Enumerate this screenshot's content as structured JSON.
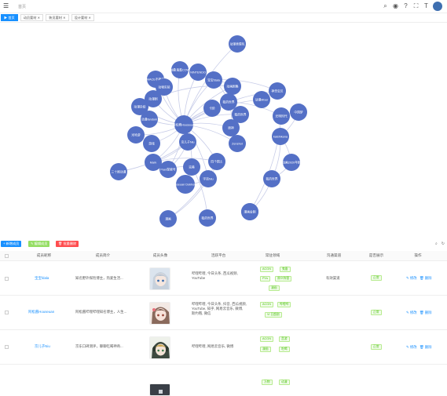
{
  "topbar": {
    "breadcrumb": "首页"
  },
  "tabs": [
    {
      "label": "▶ 首页"
    },
    {
      "label": "动员要材 ✕"
    },
    {
      "label": "装员要材 ✕"
    },
    {
      "label": "设计要材 ✕"
    }
  ],
  "colors": {
    "node": "#5470c6",
    "edge": "#c8cde8",
    "primary": "#1890ff",
    "success": "#52c41a",
    "danger": "#ff4d4f",
    "success_light": "#95de64"
  },
  "graph": {
    "nodes": [
      {
        "id": "n1",
        "label": "动漫表情包"
      },
      {
        "id": "n2",
        "label": "抽象鬼畜COW"
      },
      {
        "id": "n3",
        "label": "NINTENDO"
      },
      {
        "id": "n4",
        "label": "MACE不稳定"
      },
      {
        "id": "n5",
        "label": "动物实验"
      },
      {
        "id": "n6",
        "label": "宝宝fdala"
      },
      {
        "id": "n7",
        "label": "动画剧集"
      },
      {
        "id": "n8",
        "label": "动漫剧"
      },
      {
        "id": "n9",
        "label": "我的世界"
      },
      {
        "id": "n10",
        "label": "神奇宝贝"
      },
      {
        "id": "n11",
        "label": "动漫Mixer"
      },
      {
        "id": "n12",
        "label": "动漫杂烩"
      },
      {
        "id": "n13",
        "label": "动漫fandom"
      },
      {
        "id": "n14",
        "label": "阿松酱Houseuan"
      },
      {
        "id": "n15",
        "label": "卡阶"
      },
      {
        "id": "n16",
        "label": "我的世界"
      },
      {
        "id": "n17",
        "label": "原神"
      },
      {
        "id": "n18",
        "label": "米哈游"
      },
      {
        "id": "n19",
        "label": "游戏"
      },
      {
        "id": "n20",
        "label": "Zenshot"
      },
      {
        "id": "n21",
        "label": "京儿子Niu"
      },
      {
        "id": "n22",
        "label": "Mark"
      },
      {
        "id": "n23",
        "label": "Peer探索号"
      },
      {
        "id": "n24",
        "label": "完美"
      },
      {
        "id": "n25",
        "label": "四个国土"
      },
      {
        "id": "n26",
        "label": "三十剧动漫"
      },
      {
        "id": "n27",
        "label": "宇宙Niu"
      },
      {
        "id": "n28",
        "label": "Houseuan Dokholidal"
      },
      {
        "id": "n29",
        "label": "漫画"
      },
      {
        "id": "n30",
        "label": "我的世界"
      },
      {
        "id": "n31",
        "label": "光荣"
      },
      {
        "id": "n32",
        "label": "光明时代"
      },
      {
        "id": "n33",
        "label": "中国梦"
      },
      {
        "id": "n34",
        "label": "kaishikana"
      },
      {
        "id": "n35",
        "label": "动画2020年剧"
      },
      {
        "id": "n36",
        "label": "我的世界"
      },
      {
        "id": "n37",
        "label": "漫画金刚"
      }
    ],
    "edges": [
      [
        "n14",
        "n1"
      ],
      [
        "n14",
        "n2"
      ],
      [
        "n14",
        "n3"
      ],
      [
        "n14",
        "n4"
      ],
      [
        "n14",
        "n5"
      ],
      [
        "n14",
        "n6"
      ],
      [
        "n14",
        "n7"
      ],
      [
        "n14",
        "n8"
      ],
      [
        "n14",
        "n9"
      ],
      [
        "n14",
        "n10"
      ],
      [
        "n14",
        "n11"
      ],
      [
        "n14",
        "n12"
      ],
      [
        "n14",
        "n13"
      ],
      [
        "n14",
        "n15"
      ],
      [
        "n14",
        "n16"
      ],
      [
        "n14",
        "n17"
      ],
      [
        "n14",
        "n18"
      ],
      [
        "n14",
        "n19"
      ],
      [
        "n14",
        "n20"
      ],
      [
        "n14",
        "n21"
      ],
      [
        "n14",
        "n22"
      ],
      [
        "n14",
        "n23"
      ],
      [
        "n14",
        "n24"
      ],
      [
        "n14",
        "n25"
      ],
      [
        "n14",
        "n27"
      ],
      [
        "n6",
        "n3"
      ],
      [
        "n6",
        "n10"
      ],
      [
        "n6",
        "n9"
      ],
      [
        "n6",
        "n7"
      ],
      [
        "n8",
        "n7"
      ],
      [
        "n9",
        "n17"
      ],
      [
        "n9",
        "n32"
      ],
      [
        "n21",
        "n26"
      ],
      [
        "n21",
        "n22"
      ],
      [
        "n21",
        "n23"
      ],
      [
        "n22",
        "n25"
      ],
      [
        "n23",
        "n24"
      ],
      [
        "n25",
        "n27"
      ],
      [
        "n27",
        "n28"
      ],
      [
        "n27",
        "n29"
      ],
      [
        "n25",
        "n29"
      ],
      [
        "n24",
        "n30"
      ],
      [
        "n32",
        "n31"
      ],
      [
        "n32",
        "n33"
      ],
      [
        "n33",
        "n34"
      ],
      [
        "n34",
        "n35"
      ],
      [
        "n35",
        "n36"
      ],
      [
        "n34",
        "n36"
      ],
      [
        "n36",
        "n37"
      ]
    ]
  },
  "toolbar": {
    "add_label": "+ 新增成员",
    "edit_label": "✎ 编辑成员",
    "delete_label": "🗑 批量删除",
    "search_icon": "search-icon",
    "refresh_icon": "refresh-icon"
  },
  "table": {
    "columns": [
      "成员昵称",
      "成员简介",
      "成员头像",
      "活跃平台",
      "常驻领域",
      "沟通渠道",
      "是否展示",
      "操作"
    ],
    "rows": [
      {
        "name": "宝宝fdala",
        "intro": "知名野外探险博主，热爱生活...",
        "platforms": "哔哩哔哩, 今日头条, 西瓜视频, YouTube",
        "fields": [
          "ACGN",
          "鬼畜",
          "PVs",
          "原众阵营",
          "漫画"
        ],
        "channel": "有效渠道",
        "shown": "正常",
        "edit": "✎ 修改",
        "delete": "🗑 删除"
      },
      {
        "name": "阿松酱Houseuan",
        "intro": "阿松酱哔哩哔哩知名博主，人生...",
        "platforms": "哔哩哔哩, 今日头条, 抖音, 西瓜视频, YouTube, 知乎, 网易云音乐, 微博, 斯约哦, 微信",
        "fields": [
          "ACGN",
          "哔哩哔",
          "Vi 日超剧"
        ],
        "channel": "",
        "shown": "正常",
        "edit": "✎ 修改",
        "delete": "🗑 删除"
      },
      {
        "name": "京儿子Niu",
        "intro": "京东口碑测评，聊聊吃喝神奇...",
        "platforms": "哔哩哔哩, 网易云音乐, 微博",
        "fields": [
          "ACGN",
          "音游",
          "漫画",
          "吃喝"
        ],
        "channel": "",
        "shown": "正常",
        "edit": "✎ 修改",
        "delete": "🗑 删除"
      },
      {
        "name": "",
        "intro": "",
        "platforms": "",
        "fields": [
          "万物",
          "动漫"
        ],
        "channel": "",
        "shown": "",
        "edit": "",
        "delete": ""
      }
    ]
  }
}
